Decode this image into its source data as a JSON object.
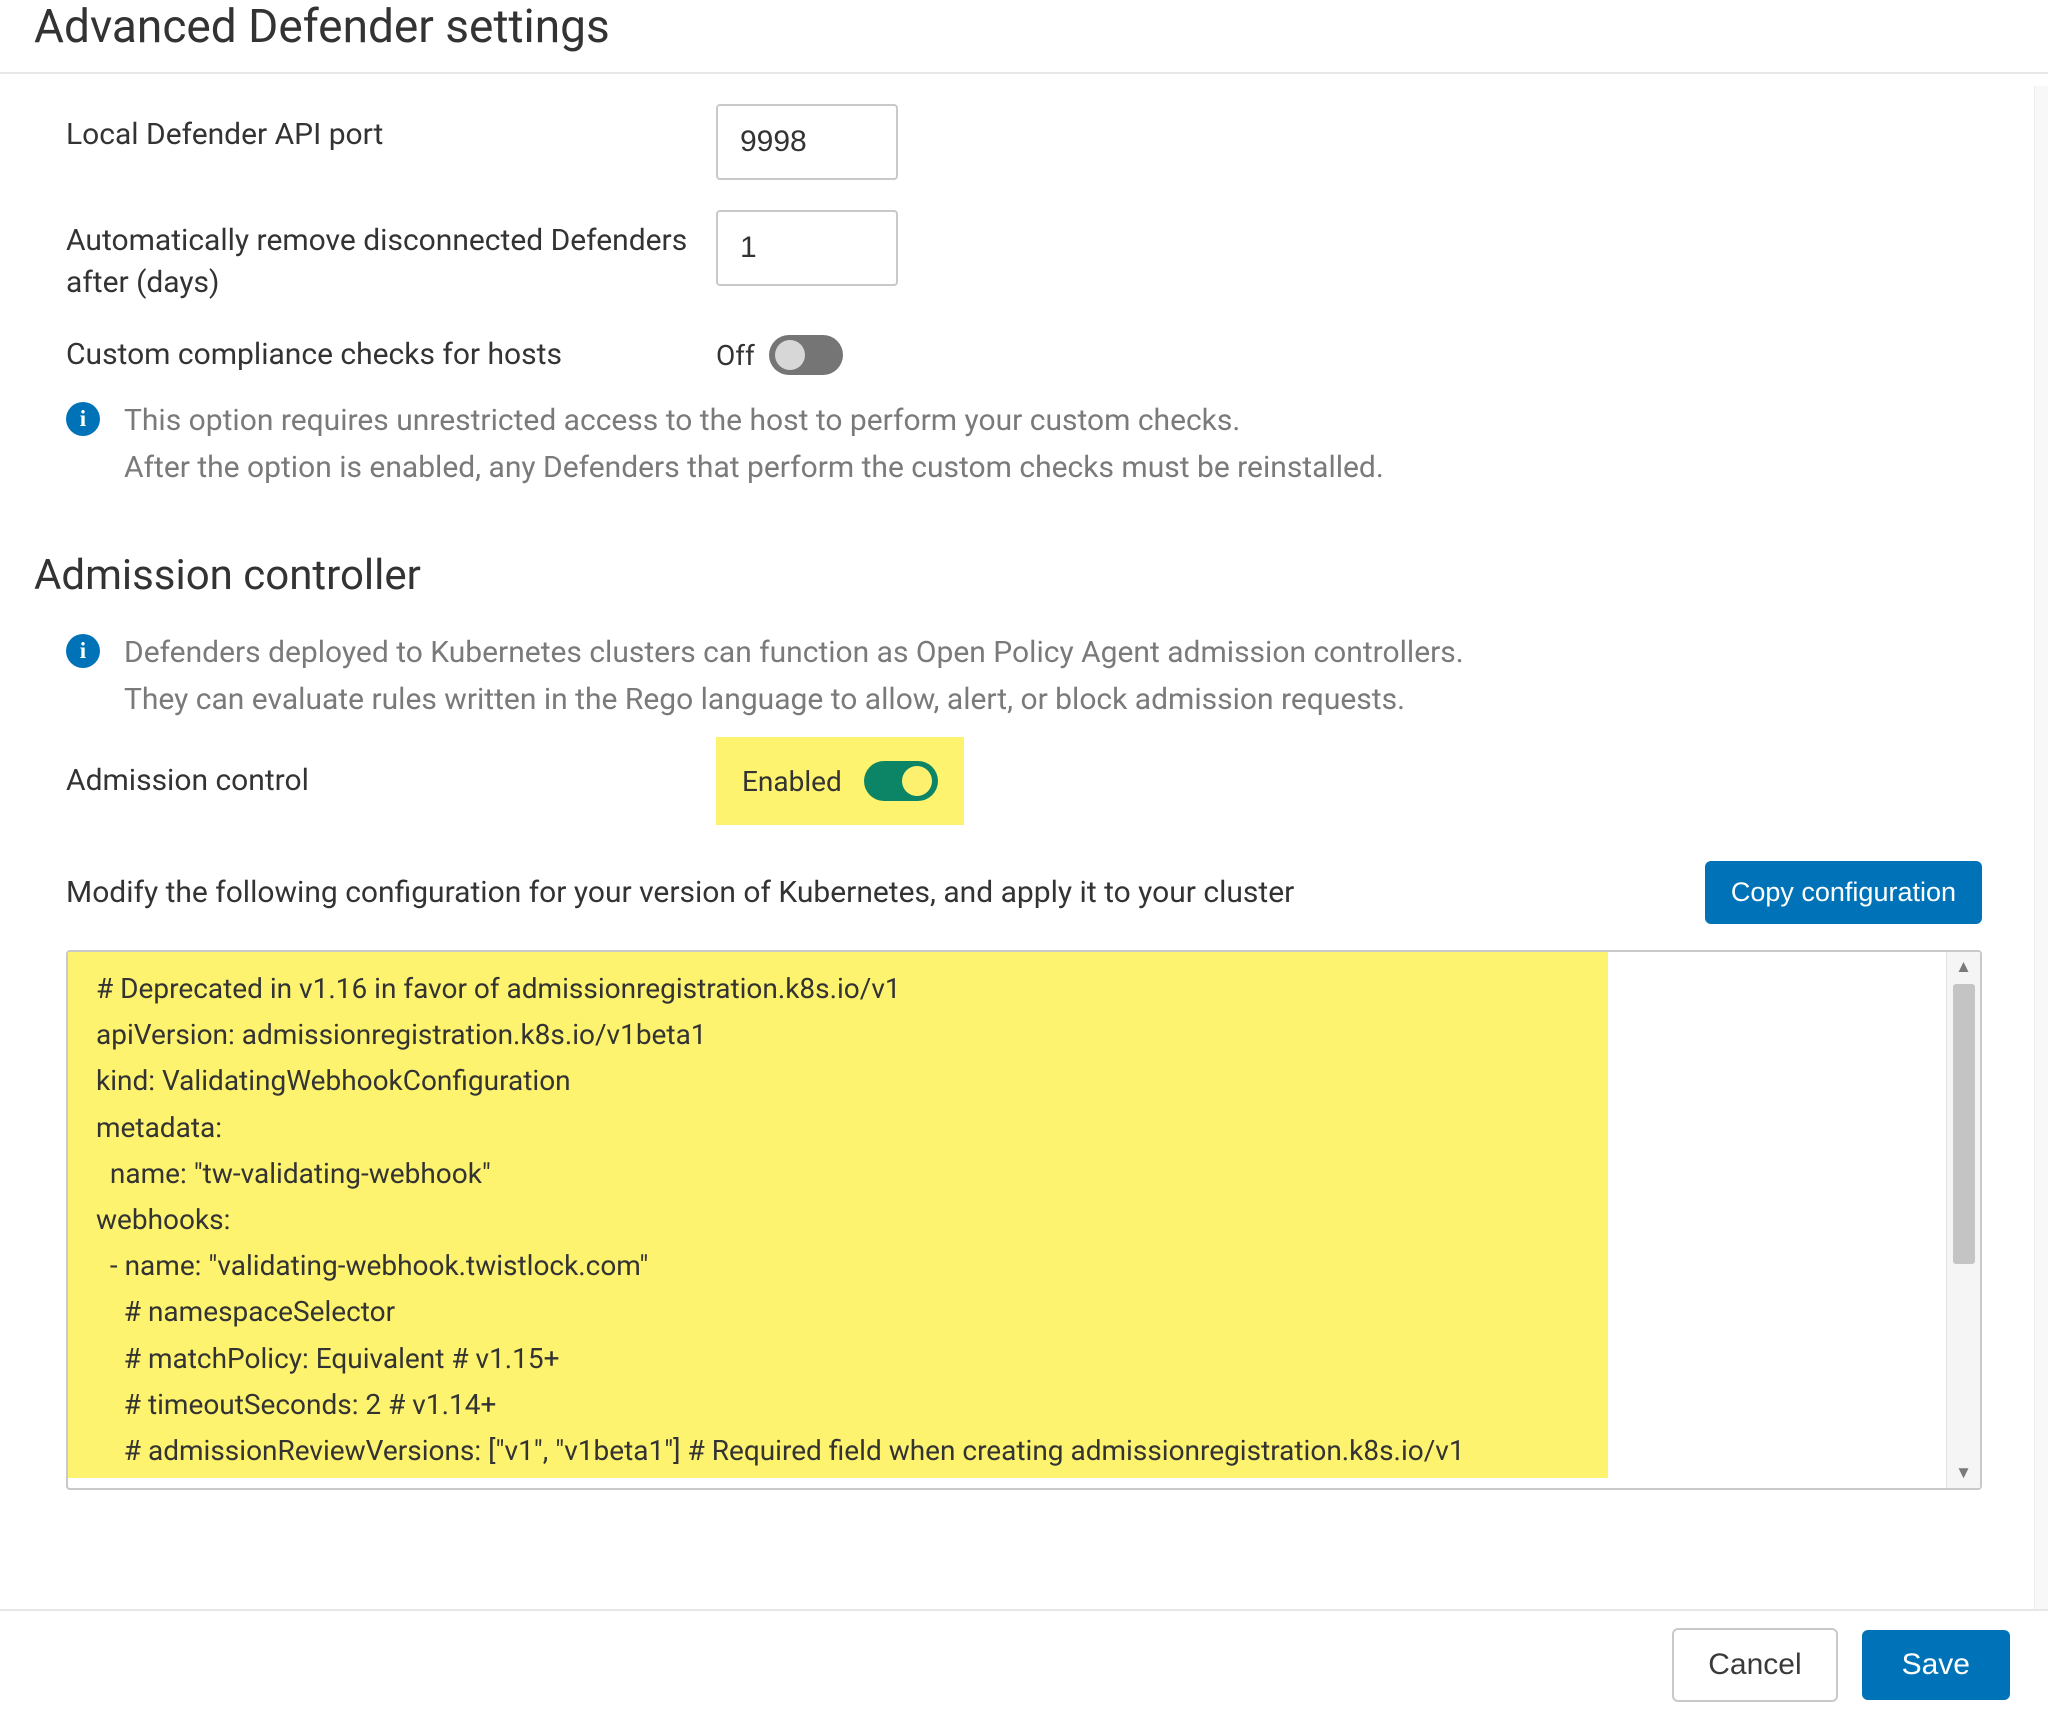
{
  "section1": {
    "title": "Advanced Defender settings",
    "api_port_label": "Local Defender API port",
    "api_port_value": "9998",
    "auto_remove_label": "Automatically remove disconnected Defenders after (days)",
    "auto_remove_value": "1",
    "custom_checks_label": "Custom compliance checks for hosts",
    "custom_checks_state": "Off",
    "info_line1": "This option requires unrestricted access to the host to perform your custom checks.",
    "info_line2": "After the option is enabled, any Defenders that perform the custom checks must be reinstalled."
  },
  "section2": {
    "title": "Admission controller",
    "info_line1": "Defenders deployed to Kubernetes clusters can function as Open Policy Agent admission controllers.",
    "info_line2": "They can evaluate rules written in the Rego language to allow, alert, or block admission requests.",
    "admission_label": "Admission control",
    "admission_state": "Enabled",
    "config_prompt": "Modify the following configuration for your version of Kubernetes, and apply it to your cluster",
    "copy_button": "Copy configuration",
    "config_text": "# Deprecated in v1.16 in favor of admissionregistration.k8s.io/v1\napiVersion: admissionregistration.k8s.io/v1beta1\nkind: ValidatingWebhookConfiguration\nmetadata:\n  name: \"tw-validating-webhook\"\nwebhooks:\n  - name: \"validating-webhook.twistlock.com\"\n    # namespaceSelector\n    # matchPolicy: Equivalent # v1.15+\n    # timeoutSeconds: 2 # v1.14+\n    # admissionReviewVersions: [\"v1\", \"v1beta1\"] # Required field when creating admissionregistration.k8s.io/v1"
  },
  "footer": {
    "cancel": "Cancel",
    "save": "Save"
  }
}
